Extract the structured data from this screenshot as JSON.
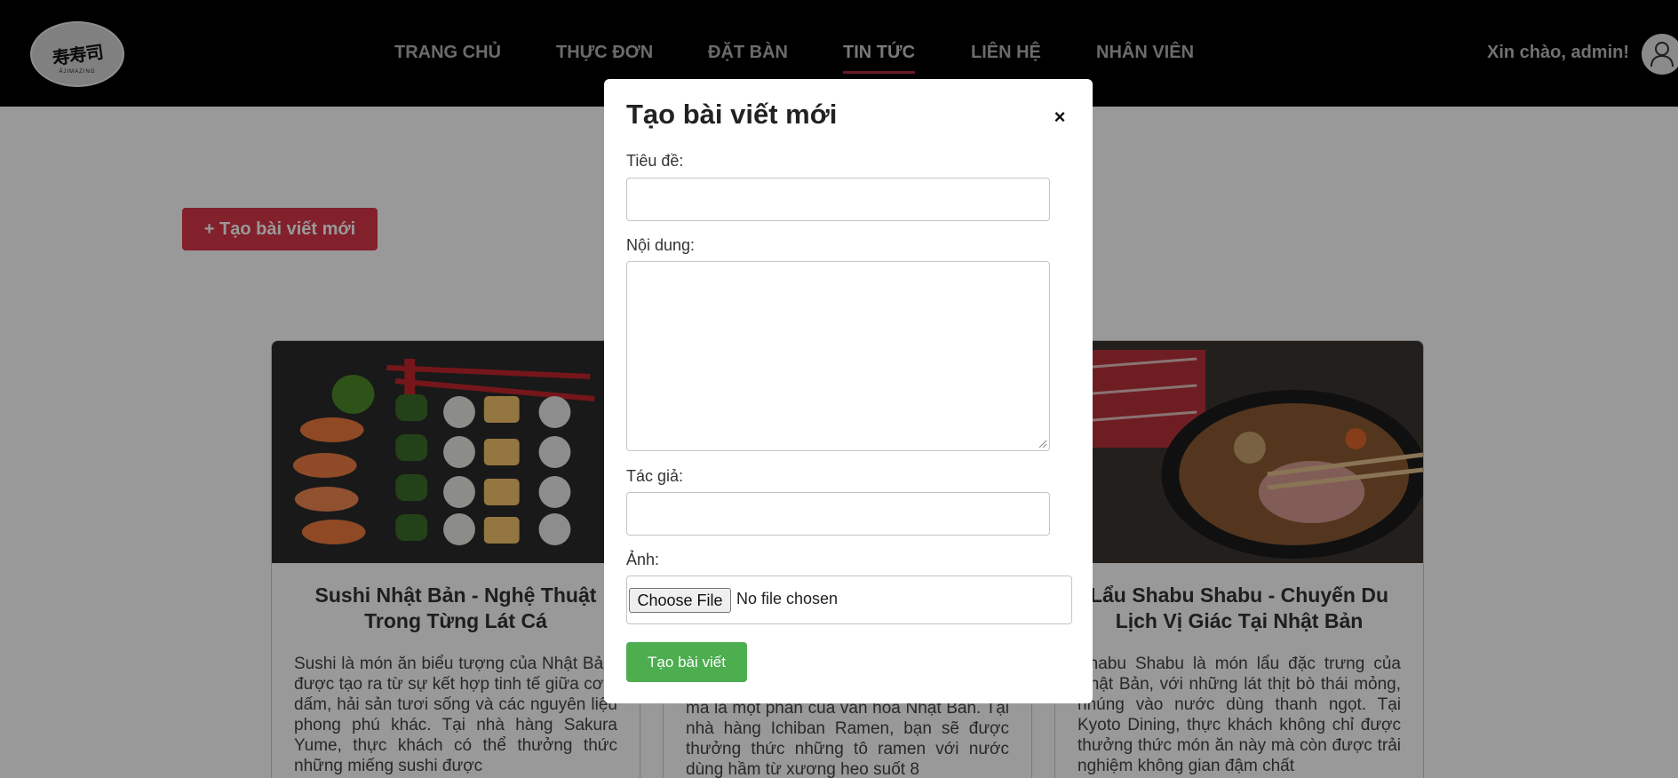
{
  "header": {
    "logo_text": "ẢJIMAZING",
    "logo_glyphs": "寿寿司",
    "nav": [
      {
        "label": "TRANG CHỦ",
        "active": false
      },
      {
        "label": "THỰC ĐƠN",
        "active": false
      },
      {
        "label": "ĐẶT BÀN",
        "active": false
      },
      {
        "label": "TIN TỨC",
        "active": true
      },
      {
        "label": "LIÊN HỆ",
        "active": false
      },
      {
        "label": "NHÂN VIÊN",
        "active": false
      }
    ],
    "greeting": "Xin chào, admin!",
    "avatar_icon": "user-icon"
  },
  "page": {
    "create_button": "+ Tạo bài viết mới"
  },
  "cards": [
    {
      "title": "Sushi Nhật Bản - Nghệ Thuật Trong Từng Lát Cá",
      "text": "Sushi là món ăn biểu tượng của Nhật Bản, được tạo ra từ sự kết hợp tinh tế giữa cơm dấm, hải sản tươi sống và các nguyên liệu phong phú khác. Tại nhà hàng Sakura Yume, thực khách có thể thưởng thức những miếng sushi được"
    },
    {
      "title": "",
      "text": "mà là một phần của văn hóa Nhật Bản. Tại nhà hàng Ichiban Ramen, bạn sẽ được thưởng thức những tô ramen với nước dùng hầm từ xương heo suốt 8"
    },
    {
      "title": "Lẩu Shabu Shabu - Chuyến Du Lịch Vị Giác Tại Nhật Bản",
      "text": "Shabu Shabu là món lẩu đặc trưng của Nhật Bản, với những lát thịt bò thái mỏng, nhúng vào nước dùng thanh ngọt. Tại Kyoto Dining, thực khách không chỉ được thưởng thức món ăn này mà còn được trải nghiệm không gian đậm chất"
    }
  ],
  "modal": {
    "title": "Tạo bài viết mới",
    "close_label": "×",
    "fields": {
      "title_label": "Tiêu đề:",
      "title_value": "",
      "content_label": "Nội dung:",
      "content_value": "",
      "author_label": "Tác giả:",
      "author_value": "",
      "image_label": "Ảnh:",
      "file_button": "Choose File",
      "file_status": "No file chosen"
    },
    "submit_label": "Tạo bài viết"
  },
  "colors": {
    "header_bg": "#000000",
    "accent_red": "#d9364a",
    "submit_green": "#4cae4f",
    "active_underline": "#b12a3c"
  }
}
